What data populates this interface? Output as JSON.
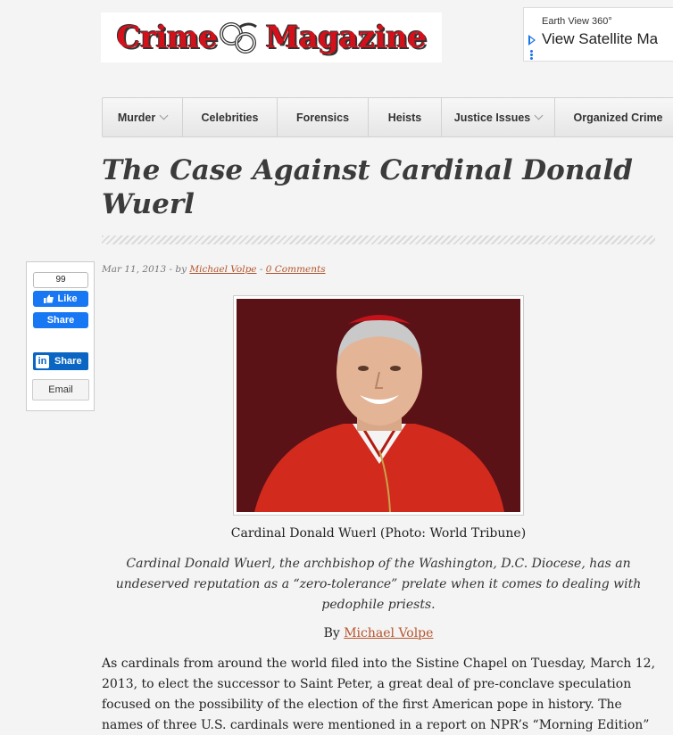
{
  "logo": {
    "left": "Crime",
    "right": "Magazine"
  },
  "ad": {
    "small": "Earth View 360°",
    "big": "View Satellite Ma"
  },
  "nav": [
    {
      "label": "Murder",
      "dropdown": true
    },
    {
      "label": "Celebrities",
      "dropdown": false
    },
    {
      "label": "Forensics",
      "dropdown": false
    },
    {
      "label": "Heists",
      "dropdown": false
    },
    {
      "label": "Justice Issues",
      "dropdown": true
    },
    {
      "label": "Organized Crime",
      "dropdown": false
    }
  ],
  "article": {
    "title": "The Case Against Cardinal Donald Wuerl",
    "date": "Mar 11, 2013 - by",
    "author": "Michael Volpe",
    "comments": "0 Comments",
    "caption": "Cardinal Donald Wuerl (Photo: World Tribune)",
    "dek": "Cardinal Donald Wuerl, the archbishop of the Washington, D.C. Diocese, has an undeserved reputation as a “zero-tolerance” prelate when it comes to dealing with pedophile priests.",
    "byline_prefix": "By",
    "byline_author": "Michael Volpe",
    "body": "As cardinals from around the world filed into the Sistine Chapel on Tuesday, March 12, 2013, to elect the successor to Saint Peter, a great deal of pre-conclave speculation focused on the possibility of the election of the first American pope in history. The names of three U.S. cardinals were mentioned in a report on NPR’s “Morning Edition”"
  },
  "share": {
    "count": "99",
    "like": "Like",
    "fb_share": "Share",
    "li_logo": "in",
    "li_share": "Share",
    "email": "Email"
  },
  "colors": {
    "brand_red": "#d4101a",
    "link": "#b5542c",
    "facebook": "#1877f2",
    "linkedin": "#0a66c2"
  },
  "icons": [
    "handcuffs-icon",
    "play-icon",
    "thumbs-up-icon",
    "linkedin-icon"
  ]
}
